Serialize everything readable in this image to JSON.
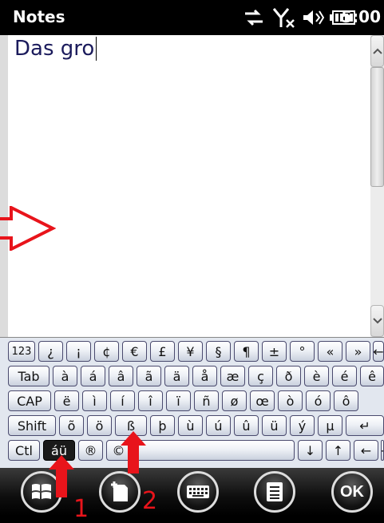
{
  "status_bar": {
    "app_title": "Notes",
    "clock": "5:00",
    "icons": [
      "data-sync-icon",
      "no-signal-icon",
      "volume-icon",
      "battery-icon"
    ]
  },
  "note": {
    "text": "Das gro"
  },
  "scrollbar": {
    "up_icon": "scroll-up-icon",
    "down_icon": "scroll-down-icon"
  },
  "keyboard": {
    "rows": [
      [
        "123",
        "¿",
        "¡",
        "¢",
        "€",
        "£",
        "¥",
        "§",
        "¶",
        "±",
        "°",
        "«",
        "»",
        "←"
      ],
      [
        "Tab",
        "à",
        "á",
        "â",
        "ã",
        "ä",
        "å",
        "æ",
        "ç",
        "ð",
        "è",
        "é",
        "ê"
      ],
      [
        "CAP",
        "ë",
        "ì",
        "í",
        "î",
        "ï",
        "ñ",
        "ø",
        "œ",
        "ò",
        "ó",
        "ô"
      ],
      [
        "Shift",
        "õ",
        "ö",
        "ß",
        "þ",
        "ù",
        "ú",
        "û",
        "ü",
        "ý",
        "µ",
        "↵"
      ],
      [
        "Ctl",
        "áü",
        "®",
        "©",
        " ",
        "↓",
        "↑",
        "←",
        "→"
      ]
    ]
  },
  "taskbar": {
    "start_icon": "windows-start-icon",
    "new_note_icon": "new-note-icon",
    "keyboard_icon": "keyboard-icon",
    "menu_icon": "menu-icon",
    "ok_label": "OK"
  },
  "annotations": {
    "label_1": "1",
    "label_2": "2",
    "accent_color": "#e8141b"
  }
}
